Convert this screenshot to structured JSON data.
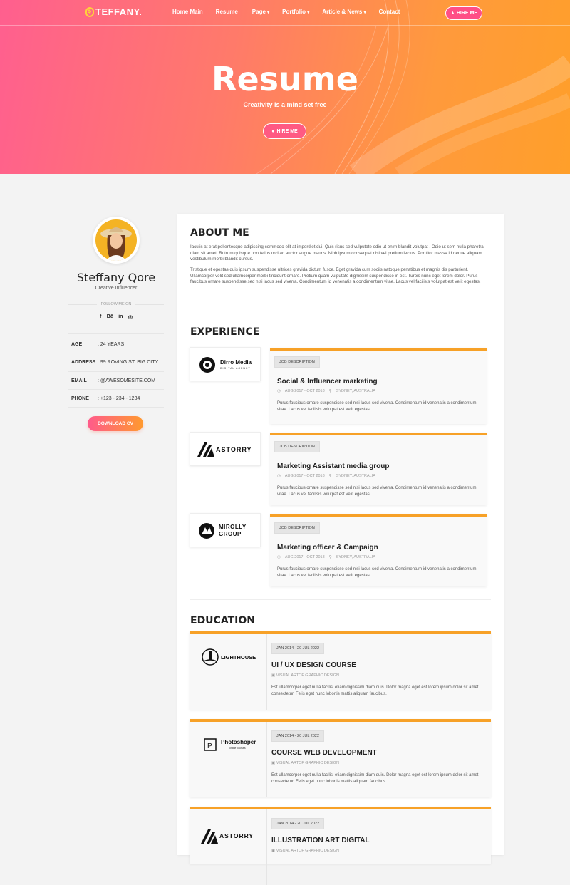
{
  "nav": {
    "brand": "TEFFANY.",
    "links": [
      "Home Main",
      "Resume",
      "Page",
      "Portfolio",
      "Article & News",
      "Contact"
    ],
    "hire_label": "HIRE ME"
  },
  "hero": {
    "title": "Resume",
    "subtitle": "Creativity is a mind set free",
    "hire_label": "HIRE ME"
  },
  "profile": {
    "name": "Steffany Qore",
    "role": "Creative Influencer",
    "follow_label": "FOLLOW ME ON",
    "socials": [
      "f",
      "Bē",
      "in",
      "◎"
    ],
    "info": [
      {
        "key": "AGE",
        "value": ": 24 YEARS"
      },
      {
        "key": "ADDRESS",
        "value": ": 99 ROVING ST. BIG CITY"
      },
      {
        "key": "EMAIL",
        "value": ": @AWESOMESITE.COM"
      },
      {
        "key": "PHONE",
        "value": ": +123 - 234 - 1234"
      }
    ],
    "download_label": "DOWNLOAD CV"
  },
  "about": {
    "heading": "ABOUT ME",
    "p1": "Iaculis at erat pellentesque adipiscing commodo elit at imperdiet dui. Quis risus sed vulputate odio ut enim blandit volutpat . Odio ut sem nulla pharetra diam sit amet. Rutrum quisque non tellus orci ac auctor augue mauris. Nibh ipsum consequat nisl vel pretium lectus. Porttitor massa id neque aliquam vestibulum morbi blandit cursus.",
    "p2": "Tristique et egestas quis ipsum suspendisse ultrices gravida dictum fusce. Eget gravida cum sociis natoque penatibus et magnis dis parturient. Ullamcorper velit sed ullamcorper morbi tincidunt ornare. Pretium quam vulputate dignissim suspendisse in est. Turpis nunc eget lorem dolor. Purus faucibus ornare suspendisse sed nisi lacus sed viverra. Condimentum id venenatis a condimentum vitae. Lacus vel facilisis volutpat est velit egestas."
  },
  "experience": {
    "heading": "EXPERIENCE",
    "tag": "JOB DESCRIPTION",
    "items": [
      {
        "company": "Dirro Media",
        "company_sub": "DIGITAL AGENCY",
        "title": "Social & Influencer marketing",
        "date": "AUG 2017 - OCT 2018",
        "location": "SYDNEY, AUSTRALIA",
        "desc": "Purus faucibus ornare suspendisse sed nisi lacus sed viverra. Condimentum id venenatis a condimentum vitae. Lacus vel facilisis volutpat est velit egestas."
      },
      {
        "company": "ASTORRY",
        "title": "Marketing Assistant media group",
        "date": "AUG 2017 - OCT 2018",
        "location": "SYDNEY, AUSTRALIA",
        "desc": "Purus faucibus ornare suspendisse sed nisi lacus sed viverra. Condimentum id venenatis a condimentum vitae. Lacus vel facilisis volutpat est velit egestas."
      },
      {
        "company": "MIROLLY",
        "company_line2": "GROUP",
        "title": "Marketing officer & Campaign",
        "date": "AUG 2017 - OCT 2018",
        "location": "SYDNEY, AUSTRALIA",
        "desc": "Purus faucibus ornare suspendisse sed nisi lacus sed viverra. Condimentum id venenatis a condimentum vitae. Lacus vel facilisis volutpat est velit egestas."
      }
    ]
  },
  "education": {
    "heading": "EDUCATION",
    "items": [
      {
        "logo": "LIGHTHOUSE",
        "date": "JAN 2014 - 20 JUL 2022",
        "title": "UI / UX DESIGN COURSE",
        "school": "VISUAL ARTOF GRAPHIC DESIGN",
        "desc": "Est ullamcorper eget nulla facilisi etiam dignissim diam quis. Dolor magna eget est lorem ipsum dolor sit amet consectetur. Felis eget nunc lobortis mattis aliquam faucibus."
      },
      {
        "logo": "Photoshoper",
        "logo_sub": "online courses",
        "date": "JAN 2014 - 20 JUL 2022",
        "title": "COURSE WEB DEVELOPMENT",
        "school": "VISUAL ARTOF GRAPHIC DESIGN",
        "desc": "Est ullamcorper eget nulla facilisi etiam dignissim diam quis. Dolor magna eget est lorem ipsum dolor sit amet consectetur. Felis eget nunc lobortis mattis aliquam faucibus."
      },
      {
        "logo": "ASTORRY",
        "date": "JAN 2014 - 20 JUL 2022",
        "title": "ILLUSTRATION ART DIGITAL",
        "school": "VISUAL ARTOF GRAPHIC DESIGN",
        "desc": ""
      }
    ]
  },
  "colors": {
    "accent": "#f7a127",
    "pink": "#ff5f8f",
    "orange": "#ff9f2a"
  }
}
